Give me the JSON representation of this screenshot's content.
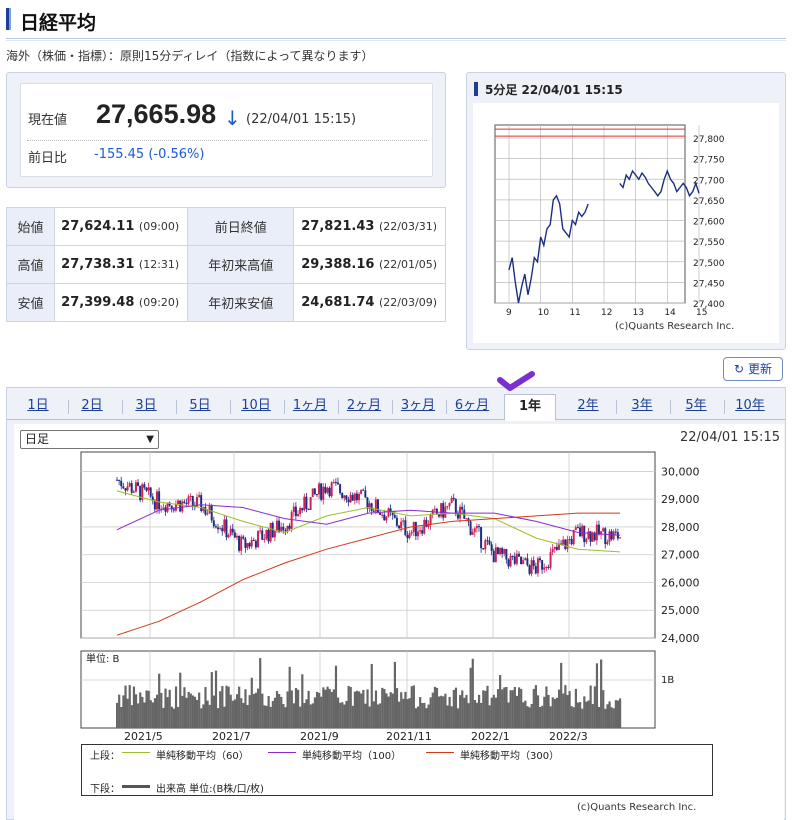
{
  "page": {
    "title": "日経平均",
    "notice": "海外（株価・指標）：原則15分ディレイ（指数によって異なります）"
  },
  "quote": {
    "current_label": "現在値",
    "current_value": "27,665.98",
    "direction_icon": "down-arrow-icon",
    "current_time": "(22/04/01 15:15)",
    "change_label": "前日比",
    "change_value": "-155.45",
    "change_pct": "(-0.56%)",
    "change_color": "#1a5bd6"
  },
  "stats": {
    "open_label": "始値",
    "open_value": "27,624.11",
    "open_time": "(09:00)",
    "prev_close_label": "前日終値",
    "prev_close_value": "27,821.43",
    "prev_close_date": "(22/03/31)",
    "high_label": "高値",
    "high_value": "27,738.31",
    "high_time": "(12:31)",
    "ytd_high_label": "年初来高値",
    "ytd_high_value": "29,388.16",
    "ytd_high_date": "(22/01/05)",
    "low_label": "安値",
    "low_value": "27,399.48",
    "low_time": "(09:20)",
    "ytd_low_label": "年初来安値",
    "ytd_low_value": "24,681.74",
    "ytd_low_date": "(22/03/09)"
  },
  "intraday": {
    "header": "5分足 22/04/01 15:15",
    "copyright": "(c)Quants Research Inc.",
    "y_ticks": [
      "27,800",
      "27,750",
      "27,700",
      "27,650",
      "27,600",
      "27,550",
      "27,500",
      "27,450",
      "27,400"
    ],
    "x_ticks": [
      "9",
      "10",
      "11",
      "12",
      "13",
      "14",
      "15"
    ],
    "chart_data": {
      "type": "line",
      "title": "",
      "ylim": [
        27380,
        27830
      ],
      "x_hours": [
        9.0,
        9.1,
        9.2,
        9.3,
        9.4,
        9.5,
        9.6,
        9.7,
        9.8,
        9.9,
        10.0,
        10.1,
        10.2,
        10.3,
        10.4,
        10.5,
        10.6,
        10.7,
        10.8,
        10.9,
        11.0,
        11.1,
        11.2,
        11.3,
        11.4,
        11.5,
        12.5,
        12.6,
        12.7,
        12.8,
        12.9,
        13.0,
        13.1,
        13.2,
        13.3,
        13.4,
        13.5,
        13.6,
        13.7,
        13.8,
        13.9,
        14.0,
        14.1,
        14.2,
        14.3,
        14.4,
        14.5,
        14.6,
        14.7,
        14.8,
        14.9,
        15.0
      ],
      "values": [
        27480,
        27510,
        27450,
        27400,
        27440,
        27470,
        27420,
        27460,
        27510,
        27500,
        27560,
        27540,
        27580,
        27590,
        27650,
        27660,
        27640,
        27580,
        27570,
        27560,
        27600,
        27590,
        27620,
        27610,
        27620,
        27640,
        27690,
        27680,
        27710,
        27700,
        27720,
        27710,
        27700,
        27715,
        27705,
        27690,
        27680,
        27670,
        27660,
        27670,
        27700,
        27720,
        27700,
        27690,
        27670,
        27680,
        27690,
        27680,
        27660,
        27670,
        27690,
        27666
      ],
      "reference_line": 27821.43
    }
  },
  "refresh_label": "更新",
  "tabs": [
    "1日",
    "2日",
    "3日",
    "5日",
    "10日",
    "1ヶ月",
    "2ヶ月",
    "3ヶ月",
    "6ヶ月",
    "1年",
    "2年",
    "3年",
    "5年",
    "10年"
  ],
  "active_tab": "1年",
  "chart_controls": {
    "period_select": "日足",
    "timestamp": "22/04/01 15:15"
  },
  "main_chart": {
    "price_ticks": [
      "30,000",
      "29,000",
      "28,000",
      "27,000",
      "26,000",
      "25,000",
      "24,000"
    ],
    "volume_unit": "単位: B",
    "volume_tick": "1B",
    "x_labels": [
      "2021/5",
      "2021/7",
      "2021/9",
      "2021/11",
      "2022/1",
      "2022/3"
    ],
    "legend_top_label": "上段：",
    "legend_bottom_label": "下段：",
    "legend_items": [
      {
        "name": "単純移動平均（60）",
        "color": "#9bbf2a"
      },
      {
        "name": "単純移動平均（100）",
        "color": "#8a2bd0"
      },
      {
        "name": "単純移動平均（300）",
        "color": "#d03a1a"
      }
    ],
    "volume_legend": "出来高 単位:(B株/口/枚)",
    "copyright": "(c)Quants Research Inc.",
    "chart_data": {
      "type": "candlestick",
      "title": "",
      "ylim": [
        24000,
        30700
      ],
      "monthly_close_approx": [
        {
          "x": "2021/4",
          "value": 29700
        },
        {
          "x": "2021/5",
          "value": 28900
        },
        {
          "x": "2021/6",
          "value": 28800
        },
        {
          "x": "2021/7",
          "value": 27300
        },
        {
          "x": "2021/8",
          "value": 28100
        },
        {
          "x": "2021/9",
          "value": 29500
        },
        {
          "x": "2021/10",
          "value": 28900
        },
        {
          "x": "2021/11",
          "value": 27800
        },
        {
          "x": "2021/12",
          "value": 28800
        },
        {
          "x": "2022/1",
          "value": 27000
        },
        {
          "x": "2022/2",
          "value": 26500
        },
        {
          "x": "2022/3",
          "value": 27800
        },
        {
          "x": "2022/4",
          "value": 27666
        }
      ],
      "ma60_approx": [
        29300,
        28900,
        28700,
        28200,
        27800,
        28400,
        28700,
        28400,
        28500,
        28300,
        27600,
        27200,
        27100
      ],
      "ma100_approx": [
        27900,
        28600,
        28800,
        28700,
        28300,
        28100,
        28500,
        28600,
        28500,
        28500,
        28200,
        27800,
        27700
      ],
      "ma300_approx": [
        24100,
        24600,
        25300,
        26100,
        26700,
        27200,
        27600,
        28000,
        28200,
        28300,
        28400,
        28500,
        28500
      ]
    }
  }
}
